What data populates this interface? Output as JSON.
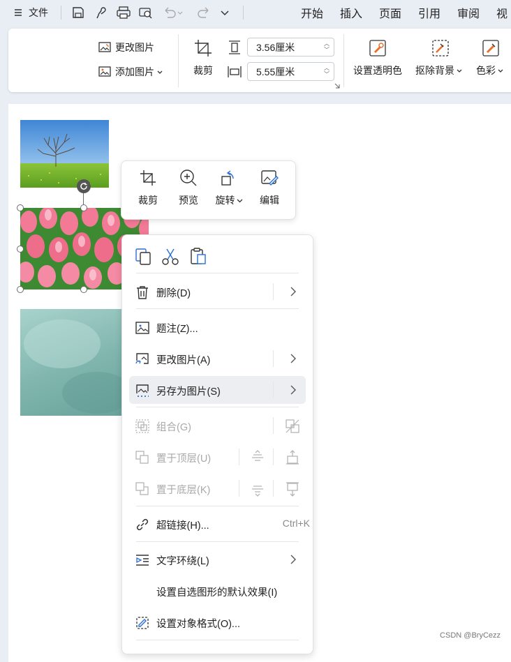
{
  "titlebar": {
    "menu_icon": "hamburger-icon",
    "file_label": "文件",
    "quick_icons": [
      "save-icon",
      "brush-icon",
      "print-icon",
      "print-preview-icon",
      "undo-icon",
      "redo-icon",
      "more-icon"
    ],
    "tabs": [
      "开始",
      "插入",
      "页面",
      "引用",
      "审阅",
      "视"
    ]
  },
  "ribbon": {
    "change_picture": "更改图片",
    "add_picture": "添加图片",
    "crop": "裁剪",
    "height_value": "3.56厘米",
    "width_value": "5.55厘米",
    "set_transparent": "设置透明色",
    "remove_bg": "抠除背景",
    "color": "色彩"
  },
  "float_toolbar": {
    "crop": "裁剪",
    "preview": "预览",
    "rotate": "旋转",
    "edit": "编辑"
  },
  "context_menu": {
    "clipboard_icons": [
      "copy-icon",
      "cut-icon",
      "paste-icon"
    ],
    "delete": "删除(D)",
    "caption": "题注(Z)...",
    "change_picture": "更改图片(A)",
    "save_as_picture": "另存为图片(S)",
    "group": "组合(G)",
    "bring_to_top": "置于顶层(U)",
    "send_to_bottom": "置于底层(K)",
    "hyperlink": "超链接(H)...",
    "hyperlink_shortcut": "Ctrl+K",
    "text_wrap": "文字环绕(L)",
    "set_default_effect": "设置自选图形的默认效果(I)",
    "format_object": "设置对象格式(O)..."
  },
  "watermark": "CSDN @BryCezz",
  "colors": {
    "accent": "#2b6fd6",
    "icon_orange": "#e8702a",
    "hover_bg": "#eceef1"
  }
}
